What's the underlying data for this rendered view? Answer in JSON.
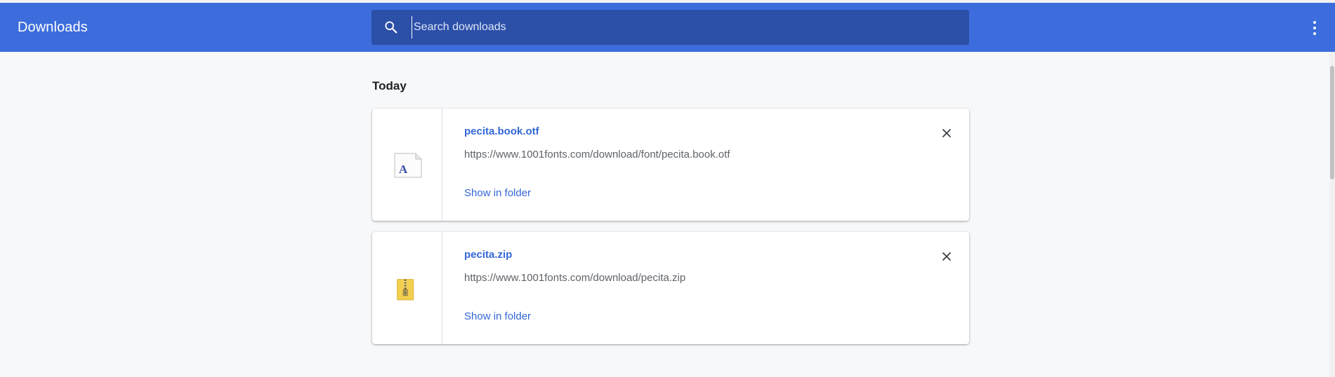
{
  "header": {
    "title": "Downloads",
    "search_placeholder": "Search downloads",
    "search_value": "",
    "search_icon": "search-icon",
    "menu_icon": "more-vert-icon",
    "color": "#3d6ddc",
    "search_bg": "#2c4fa8"
  },
  "section": {
    "title": "Today"
  },
  "downloads": [
    {
      "file_name": "pecita.book.otf",
      "url": "https://www.1001fonts.com/download/font/pecita.book.otf",
      "action": "Show in folder",
      "icon": "font-file-icon",
      "remove_icon": "close-icon"
    },
    {
      "file_name": "pecita.zip",
      "url": "https://www.1001fonts.com/download/pecita.zip",
      "action": "Show in folder",
      "icon": "zip-file-icon",
      "remove_icon": "close-icon"
    }
  ],
  "colors": {
    "link": "#3367d6",
    "secondary_text": "#5f6368",
    "background": "#f7f8fa"
  }
}
